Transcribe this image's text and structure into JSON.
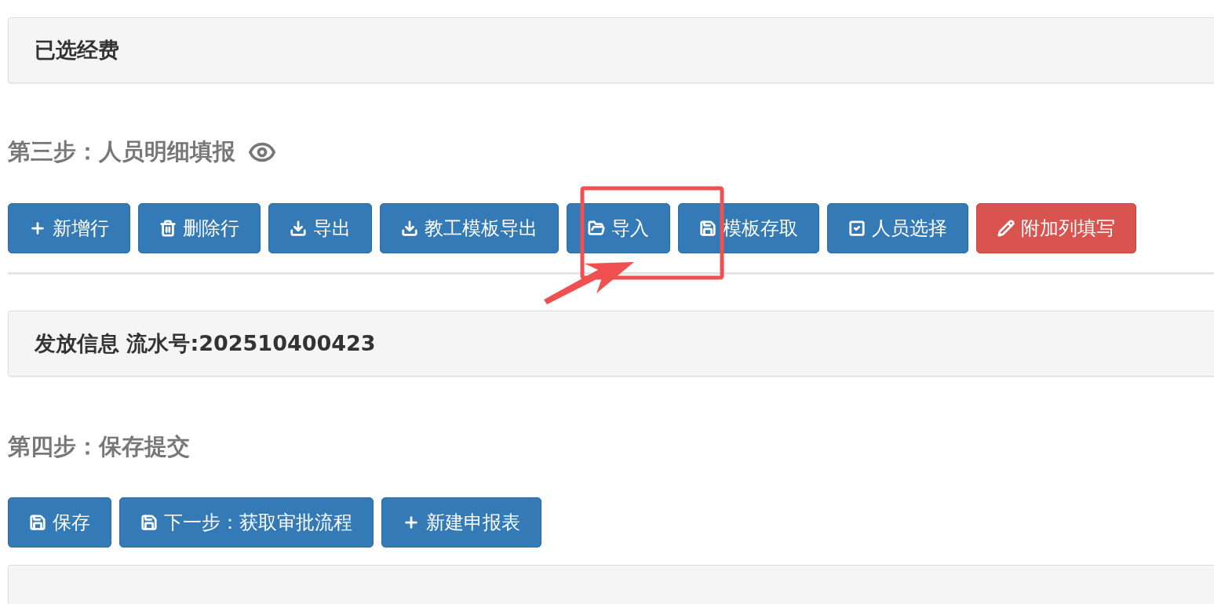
{
  "panels_top": [
    {
      "title": "已选经费"
    }
  ],
  "step3": {
    "title": "第三步：人员明细填报",
    "buttons": [
      {
        "label": "新增行"
      },
      {
        "label": "删除行"
      },
      {
        "label": "导出"
      },
      {
        "label": "教工模板导出"
      },
      {
        "label": "导入"
      },
      {
        "label": "模板存取"
      },
      {
        "label": "人员选择"
      },
      {
        "label": "附加列填写"
      }
    ]
  },
  "release_panel": {
    "title": "发放信息 流水号:202510400423"
  },
  "step4": {
    "title": "第四步：保存提交",
    "buttons": [
      {
        "label": "保存"
      },
      {
        "label": "下一步：获取审批流程"
      },
      {
        "label": "新建申报表"
      }
    ]
  }
}
